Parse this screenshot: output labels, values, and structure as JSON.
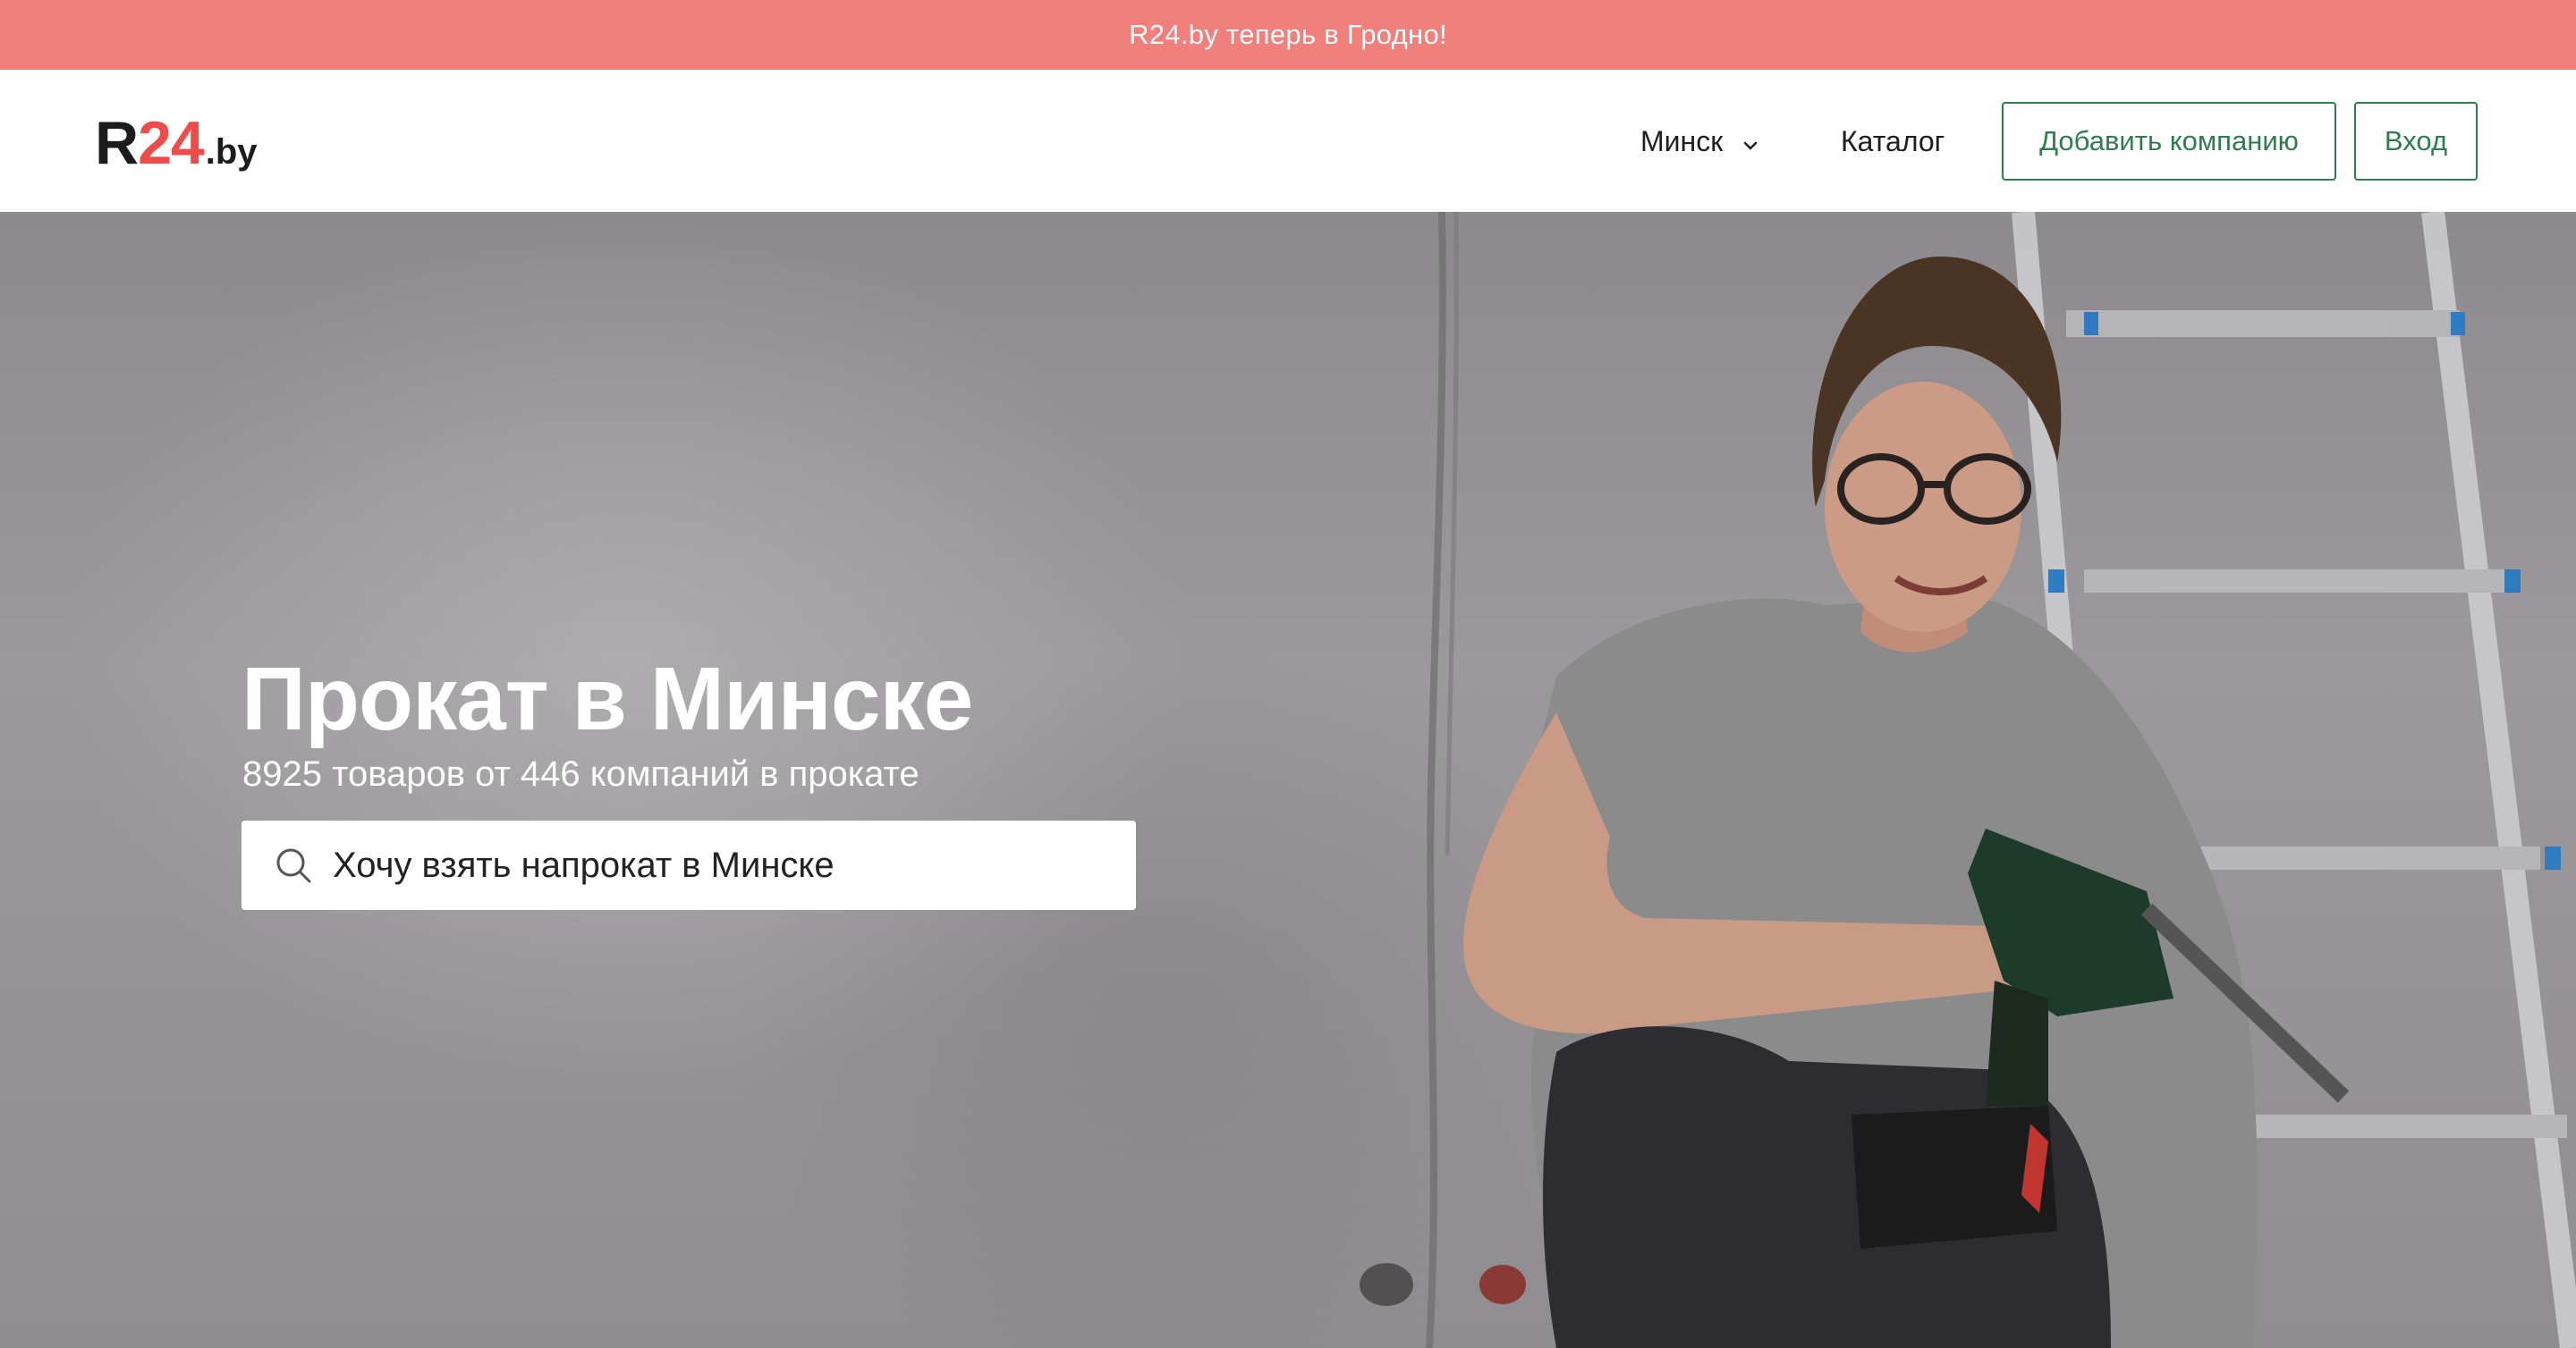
{
  "banner": {
    "text": "R24.by теперь в Гродно!"
  },
  "header": {
    "logo": {
      "r": "R",
      "num": "24",
      "tld": ".by"
    },
    "city": "Минск",
    "catalog": "Каталог",
    "add_company": "Добавить компанию",
    "login": "Вход"
  },
  "hero": {
    "title": "Прокат в Минске",
    "subtitle": "8925 товаров от 446 компаний в прокате",
    "search_placeholder": "Хочу взять напрокат в Минске"
  },
  "colors": {
    "banner": "#f17f7c",
    "logo_accent": "#ee4b49",
    "button_border": "#2e7d4f"
  },
  "icons": [
    "chevron-down-icon",
    "search-icon"
  ]
}
